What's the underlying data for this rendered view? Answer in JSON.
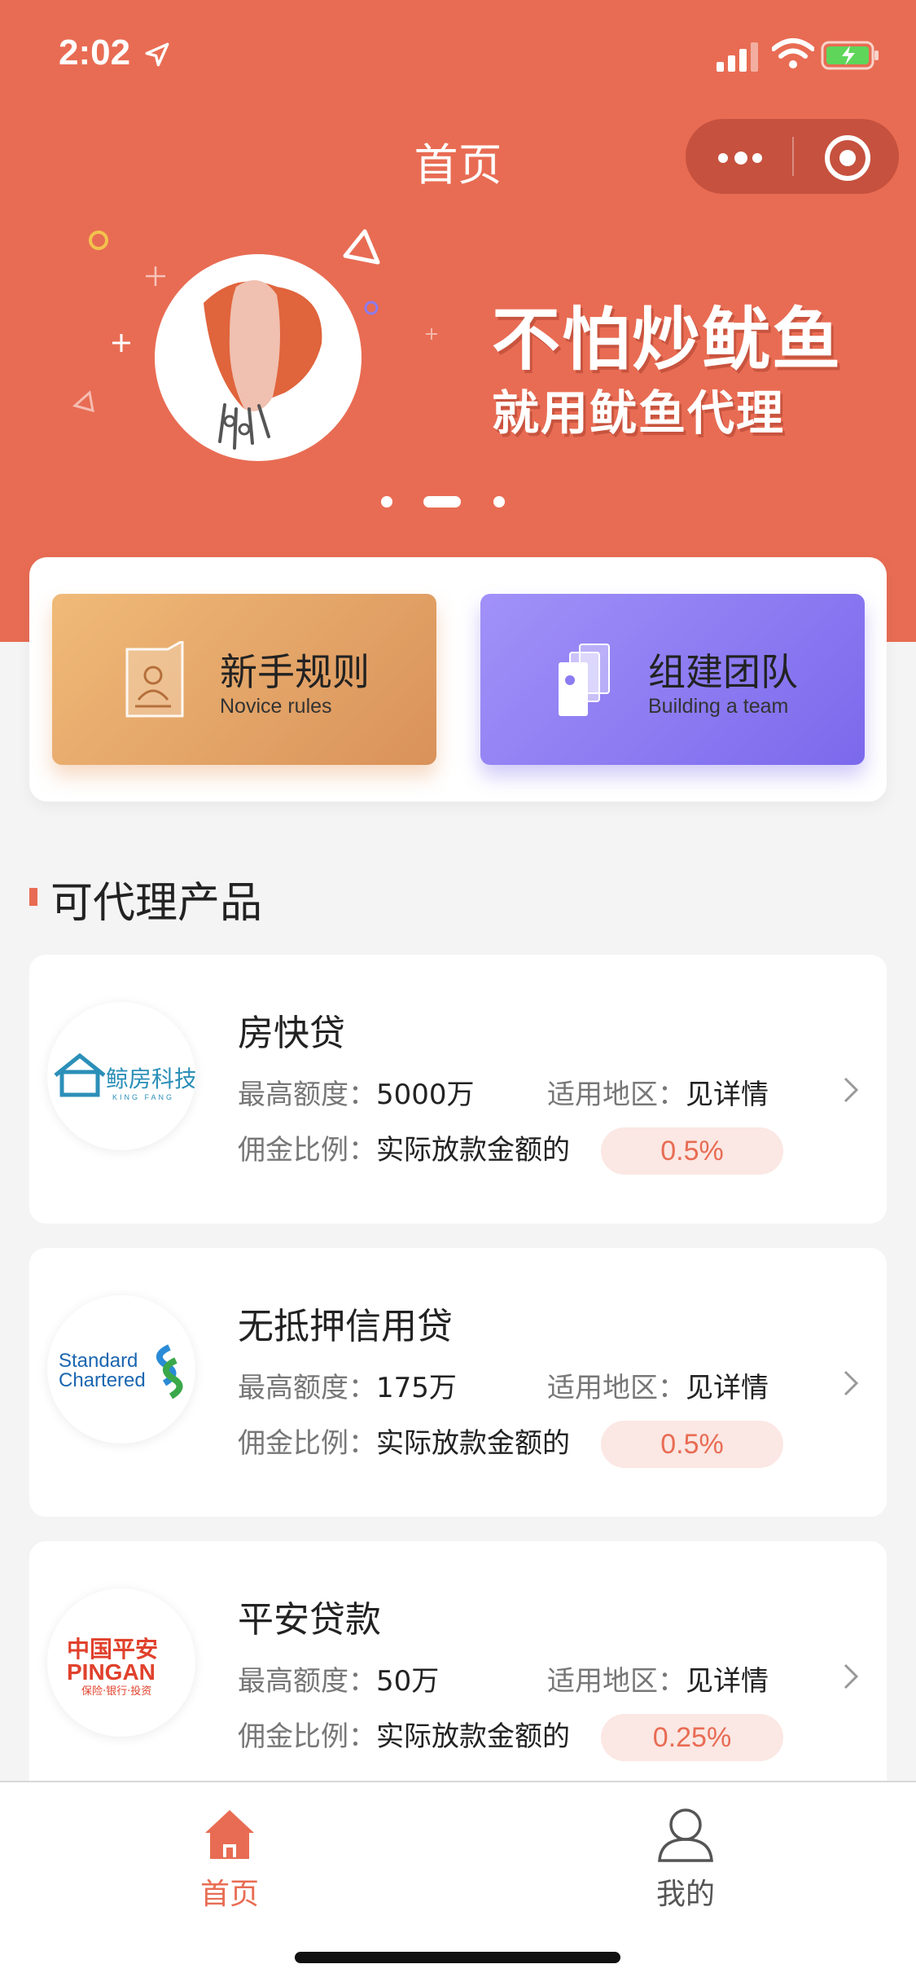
{
  "status_bar": {
    "time": "2:02"
  },
  "nav": {
    "title": "首页"
  },
  "banner": {
    "headline": "不怕炒鱿鱼",
    "subline": "就用鱿鱼代理",
    "active_slide": 2,
    "slide_count": 3
  },
  "quick_entries": [
    {
      "title": "新手规则",
      "subtitle": "Novice rules"
    },
    {
      "title": "组建团队",
      "subtitle": "Building a team"
    }
  ],
  "section": {
    "title": "可代理产品"
  },
  "products": [
    {
      "name": "房快贷",
      "logo_text": "鲸房科技",
      "logo_sub": "KING FANG",
      "max_label": "最高额度：",
      "max_value": "5000万",
      "region_label": "适用地区：",
      "region_value": "见详情",
      "commission_label": "佣金比例：",
      "commission_desc": "实际放款金额的",
      "commission_rate": "0.5%"
    },
    {
      "name": "无抵押信用贷",
      "logo_text": "Standard",
      "logo_sub": "Chartered",
      "max_label": "最高额度：",
      "max_value": "175万",
      "region_label": "适用地区：",
      "region_value": "见详情",
      "commission_label": "佣金比例：",
      "commission_desc": "实际放款金额的",
      "commission_rate": "0.5%"
    },
    {
      "name": "平安贷款",
      "logo_text": "中国平安",
      "logo_sub": "PINGAN",
      "logo_tag": "保险·银行·投资",
      "max_label": "最高额度：",
      "max_value": "50万",
      "region_label": "适用地区：",
      "region_value": "见详情",
      "commission_label": "佣金比例：",
      "commission_desc": "实际放款金额的",
      "commission_rate": "0.25%"
    }
  ],
  "tabbar": [
    {
      "label": "首页",
      "active": true
    },
    {
      "label": "我的",
      "active": false
    }
  ],
  "colors": {
    "accent": "#e86c53",
    "novice": "#e3a266",
    "team": "#8c7cf3"
  }
}
